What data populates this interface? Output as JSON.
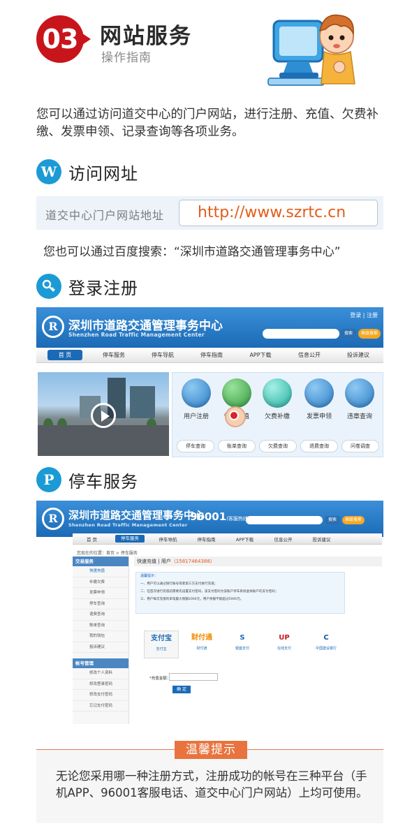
{
  "header": {
    "badge_number": "03",
    "title": "网站服务",
    "subtitle": "操作指南"
  },
  "intro": "您可以通过访问道交中心的门户网站，进行注册、充值、欠费补缴、发票申领、记录查询等各项业务。",
  "section_url": {
    "icon": "W",
    "title": "访问网址",
    "label": "道交中心门户网站地址",
    "url": "http://www.szrtc.cn",
    "baidu": "您也可以通过百度搜索：“深圳市道路交通管理事务中心”"
  },
  "section_login": {
    "title": "登录注册",
    "portal": {
      "logo_letter": "R",
      "name_cn": "深圳市道路交通管理事务中心",
      "name_en": "Shenzhen Road Traffic Management Center",
      "toplinks": "登录 | 注册",
      "search_btn": "搜索",
      "adv_btn": "高级搜索",
      "nav": [
        "首 页",
        "停车服务",
        "停车导航",
        "停车指南",
        "APP下载",
        "信息公开",
        "投诉建议"
      ],
      "services": [
        "用户注册",
        "快速充值",
        "欠费补缴",
        "发票申领",
        "违章查询"
      ],
      "quick_links": [
        "停车查询",
        "账单查询",
        "欠费查询",
        "退费查询",
        "问卷调查"
      ]
    }
  },
  "section_parking": {
    "icon": "P",
    "title": "停车服务",
    "portal": {
      "hotline": "96001",
      "hotline_note": "(客服热线)",
      "nav": [
        "首 页",
        "停车服务",
        "停车导航",
        "停车指南",
        "APP下载",
        "信息公开",
        "投诉建议"
      ],
      "breadcrumb": "您现在的位置：首页 > 停车服务",
      "side_head_1": "交易服务",
      "side_items_1": [
        "快速充值",
        "补缴欠费",
        "发票申领",
        "停车查询",
        "退费查询",
        "账单查询",
        "我的钱包",
        "投诉建议"
      ],
      "side_head_2": "帐号管理",
      "side_items_2": [
        "修改个人资料",
        "修改登录密码",
        "修改支付密码",
        "忘记支付密码"
      ],
      "main_title": "快速充值 | 用户",
      "main_phone": "（15817464388）",
      "tip_title": "温馨提示：",
      "tips": [
        "一、用户可以通过银行账号或者第三方支付进行充值；",
        "二、在首次进行充值前需要先设置支付密码，该支付密码为该账户停车系统虚拟账户的支付密码；",
        "三、用户每次充值的单笔最大限额2000元，用户余额不能超过5000元。"
      ],
      "payments": [
        {
          "mark": "支付宝",
          "label": "支付宝",
          "color": "#1b6ab6"
        },
        {
          "mark": "财付通",
          "label": "财付通",
          "color": "#f08a00"
        },
        {
          "mark": "S",
          "label": "银盛支付",
          "color": "#1b6ab6"
        },
        {
          "mark": "UP",
          "label": "在线支付",
          "color": "#c8151b"
        },
        {
          "mark": "C",
          "label": "中国建设银行",
          "color": "#1b4f9c"
        }
      ],
      "amount_label": "*充值金额：",
      "confirm": "确 定"
    }
  },
  "warm_tip": {
    "title": "温馨提示",
    "text": "无论您采用哪一种注册方式，注册成功的帐号在三种平台（手机APP、96001客服电话、道交中心门户网站）上均可使用。"
  }
}
